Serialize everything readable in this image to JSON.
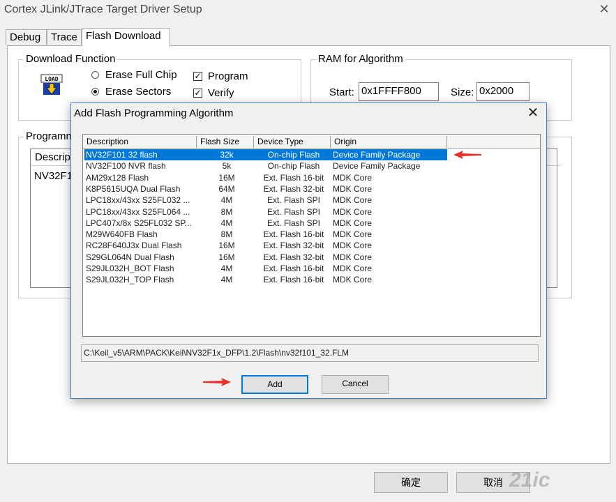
{
  "window": {
    "title": "Cortex JLink/JTrace Target Driver Setup",
    "close": "✕"
  },
  "tabs": [
    {
      "label": "Debug"
    },
    {
      "label": "Trace"
    },
    {
      "label": "Flash Download"
    }
  ],
  "download_function": {
    "label": "Download Function",
    "icon_text": "LOAD",
    "erase_full_chip": "Erase Full Chip",
    "erase_sectors": "Erase Sectors",
    "program": "Program",
    "verify": "Verify",
    "selected_option": "Erase Sectors",
    "program_checked": true,
    "verify_checked": true
  },
  "ram": {
    "label": "RAM for Algorithm",
    "start_label": "Start:",
    "start_value": "0x1FFFF800",
    "size_label": "Size:",
    "size_value": "0x2000"
  },
  "programming": {
    "label": "Programm",
    "col_desc": "Descrip",
    "first_row": "NV32F1"
  },
  "footer": {
    "ok": "确定",
    "cancel": "取消"
  },
  "dialog": {
    "title": "Add Flash Programming Algorithm",
    "close": "✕",
    "columns": [
      "Description",
      "Flash Size",
      "Device Type",
      "Origin"
    ],
    "rows": [
      {
        "desc": "NV32F101 32  flash",
        "size": "32k",
        "type": "On-chip Flash",
        "origin": "Device Family Package",
        "selected": true
      },
      {
        "desc": "NV32F100 NVR flash",
        "size": "5k",
        "type": "On-chip Flash",
        "origin": "Device Family Package"
      },
      {
        "desc": "AM29x128 Flash",
        "size": "16M",
        "type": "Ext. Flash 16-bit",
        "origin": "MDK Core"
      },
      {
        "desc": "K8P5615UQA Dual Flash",
        "size": "64M",
        "type": "Ext. Flash 32-bit",
        "origin": "MDK Core"
      },
      {
        "desc": "LPC18xx/43xx S25FL032 ...",
        "size": "4M",
        "type": "Ext. Flash SPI",
        "origin": "MDK Core"
      },
      {
        "desc": "LPC18xx/43xx S25FL064 ...",
        "size": "8M",
        "type": "Ext. Flash SPI",
        "origin": "MDK Core"
      },
      {
        "desc": "LPC407x/8x S25FL032 SP...",
        "size": "4M",
        "type": "Ext. Flash SPI",
        "origin": "MDK Core"
      },
      {
        "desc": "M29W640FB Flash",
        "size": "8M",
        "type": "Ext. Flash 16-bit",
        "origin": "MDK Core"
      },
      {
        "desc": "RC28F640J3x Dual Flash",
        "size": "16M",
        "type": "Ext. Flash 32-bit",
        "origin": "MDK Core"
      },
      {
        "desc": "S29GL064N Dual Flash",
        "size": "16M",
        "type": "Ext. Flash 32-bit",
        "origin": "MDK Core"
      },
      {
        "desc": "S29JL032H_BOT Flash",
        "size": "4M",
        "type": "Ext. Flash 16-bit",
        "origin": "MDK Core"
      },
      {
        "desc": "S29JL032H_TOP Flash",
        "size": "4M",
        "type": "Ext. Flash 16-bit",
        "origin": "MDK Core"
      }
    ],
    "path": "C:\\Keil_v5\\ARM\\PACK\\Keil\\NV32F1x_DFP\\1.2\\Flash\\nv32f101_32.FLM",
    "add": "Add",
    "cancel": "Cancel"
  },
  "watermark": "21ic",
  "colors": {
    "selection": "#0078d7",
    "arrow": "#e8302a"
  }
}
